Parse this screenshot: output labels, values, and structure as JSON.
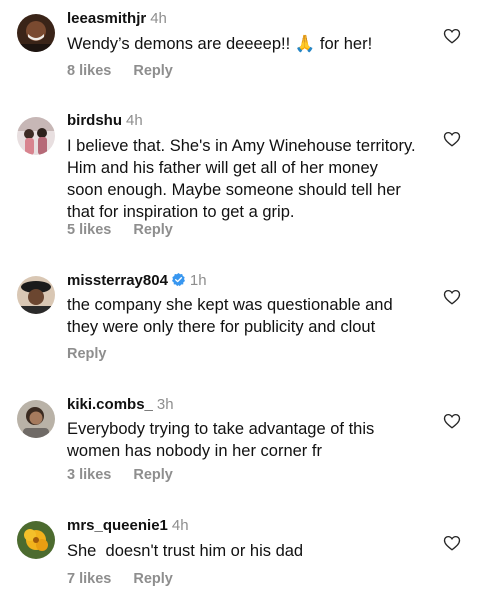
{
  "comments": [
    {
      "username": "leeasmithjr",
      "time": "4h",
      "text": "Wendy’s demons are deeeep!! 🙏 for her!",
      "likes": "8 likes",
      "reply": "Reply"
    },
    {
      "username": "birdshu",
      "time": "4h",
      "text": "I believe that. She's in Amy Winehouse territory. Him and his father will get all of her money soon enough. Maybe someone should tell her that for inspiration to get a grip.",
      "likes": "5 likes",
      "reply": "Reply"
    },
    {
      "username": "missterray804",
      "time": "1h",
      "verified": true,
      "text": "the company she kept was questionable and they were only there for publicity and clout",
      "likes": "",
      "reply": "Reply"
    },
    {
      "username": "kiki.combs_",
      "time": "3h",
      "text": "Everybody trying to take advantage of this women has nobody in her corner fr",
      "likes": "3 likes",
      "reply": "Reply"
    },
    {
      "username": "mrs_queenie1",
      "time": "4h",
      "text": "She  doesn't trust him or his dad",
      "likes": "7 likes",
      "reply": "Reply"
    }
  ],
  "colors": {
    "text": "#111111",
    "secondary": "#8e8e8e",
    "verified": "#3897f0"
  },
  "icons": {
    "like": "heart-outline-icon",
    "verified": "verified-badge-icon"
  }
}
